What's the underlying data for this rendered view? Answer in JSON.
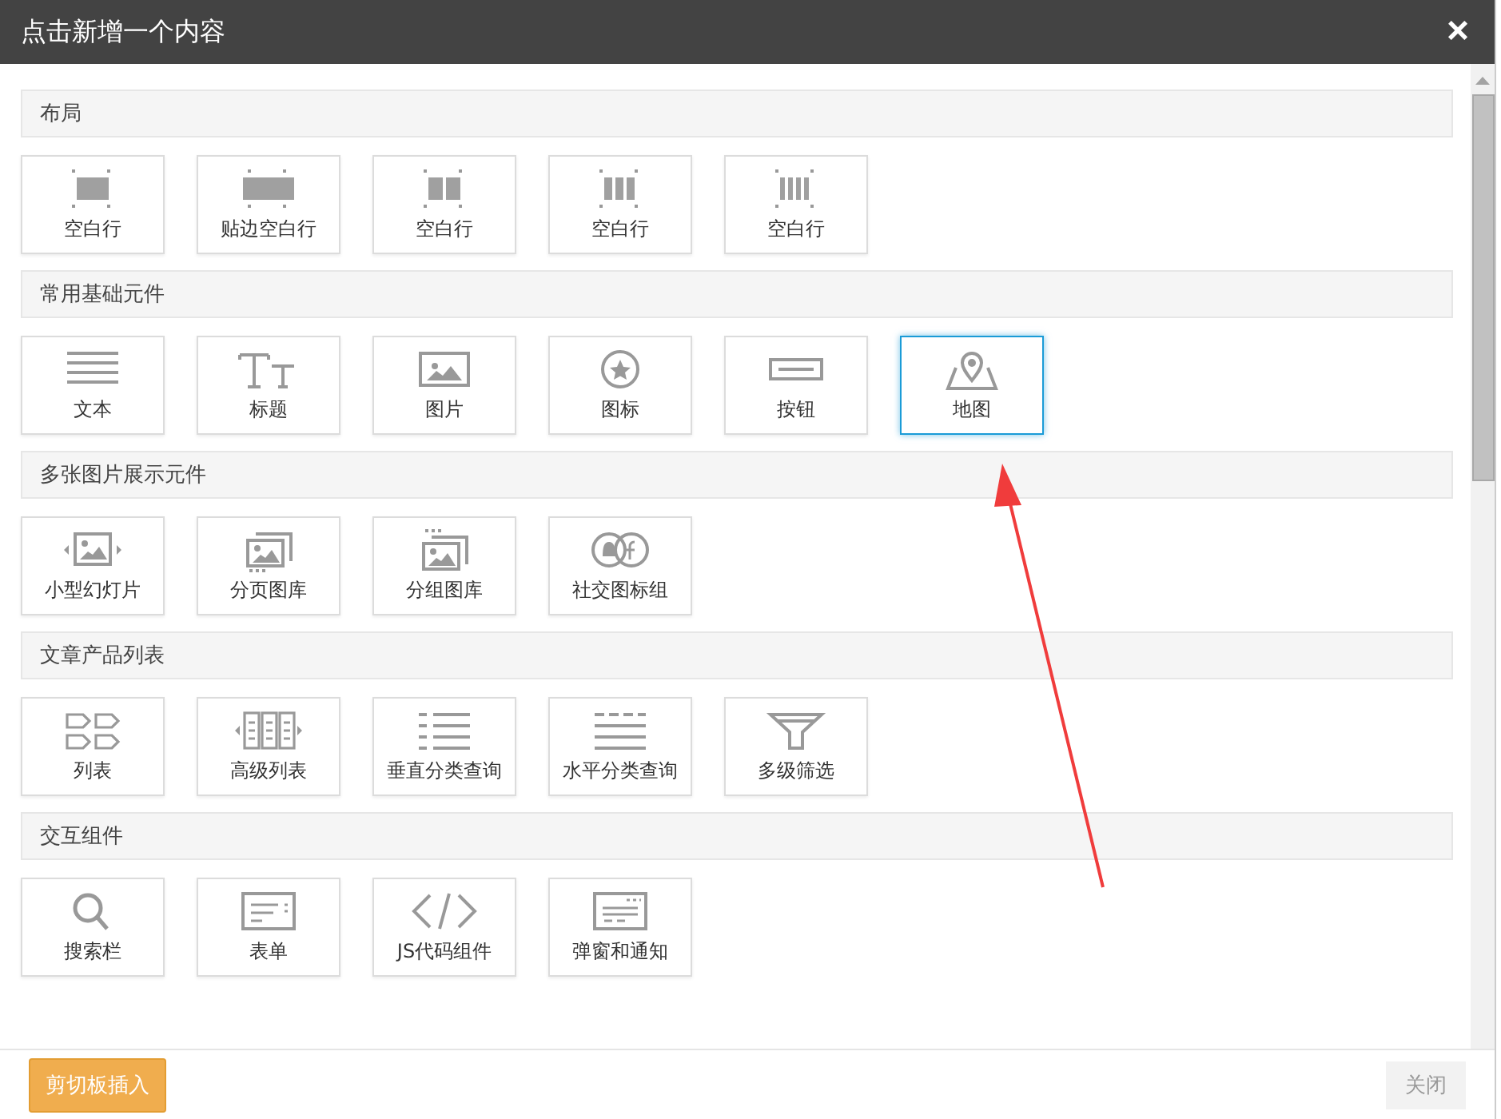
{
  "window": {
    "title": "点击新增一个内容",
    "close": "×"
  },
  "sections": [
    {
      "title": "布局",
      "items": [
        {
          "label": "空白行",
          "kind": "cols1",
          "selected": false
        },
        {
          "label": "贴边空白行",
          "kind": "full",
          "selected": false
        },
        {
          "label": "空白行",
          "kind": "cols2",
          "selected": false
        },
        {
          "label": "空白行",
          "kind": "cols3",
          "selected": false
        },
        {
          "label": "空白行",
          "kind": "cols4",
          "selected": false
        }
      ]
    },
    {
      "title": "常用基础元件",
      "items": [
        {
          "label": "文本",
          "kind": "text",
          "selected": false
        },
        {
          "label": "标题",
          "kind": "heading",
          "selected": false
        },
        {
          "label": "图片",
          "kind": "image",
          "selected": false
        },
        {
          "label": "图标",
          "kind": "star",
          "selected": false
        },
        {
          "label": "按钮",
          "kind": "button",
          "selected": false
        },
        {
          "label": "地图",
          "kind": "map",
          "selected": true
        }
      ]
    },
    {
      "title": "多张图片展示元件",
      "items": [
        {
          "label": "小型幻灯片",
          "kind": "slider",
          "selected": false
        },
        {
          "label": "分页图库",
          "kind": "gallery",
          "selected": false
        },
        {
          "label": "分组图库",
          "kind": "group",
          "selected": false
        },
        {
          "label": "社交图标组",
          "kind": "social",
          "selected": false
        }
      ]
    },
    {
      "title": "文章产品列表",
      "items": [
        {
          "label": "列表",
          "kind": "tags",
          "selected": false
        },
        {
          "label": "高级列表",
          "kind": "columns",
          "selected": false
        },
        {
          "label": "垂直分类查询",
          "kind": "vlist",
          "selected": false
        },
        {
          "label": "水平分类查询",
          "kind": "hlist",
          "selected": false
        },
        {
          "label": "多级筛选",
          "kind": "filter",
          "selected": false
        }
      ]
    },
    {
      "title": "交互组件",
      "items": [
        {
          "label": "搜索栏",
          "kind": "search",
          "selected": false
        },
        {
          "label": "表单",
          "kind": "form",
          "selected": false
        },
        {
          "label": "JS代码组件",
          "kind": "code",
          "selected": false
        },
        {
          "label": "弹窗和通知",
          "kind": "popup",
          "selected": false
        }
      ]
    }
  ],
  "footer": {
    "insert_button": "剪切板插入",
    "close_button": "关闭"
  }
}
